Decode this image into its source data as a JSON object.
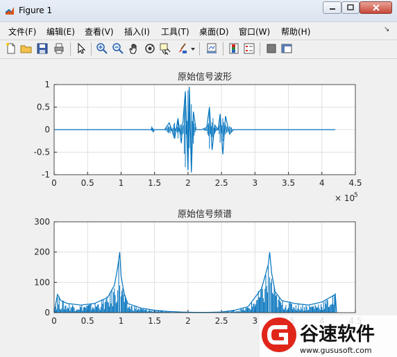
{
  "window": {
    "title": "Figure 1"
  },
  "menu": {
    "items": [
      {
        "name": "menu-file",
        "label": "文件(F)"
      },
      {
        "name": "menu-edit",
        "label": "编辑(E)"
      },
      {
        "name": "menu-view",
        "label": "查看(V)"
      },
      {
        "name": "menu-insert",
        "label": "插入(I)"
      },
      {
        "name": "menu-tools",
        "label": "工具(T)"
      },
      {
        "name": "menu-desktop",
        "label": "桌面(D)"
      },
      {
        "name": "menu-window",
        "label": "窗口(W)"
      },
      {
        "name": "menu-help",
        "label": "帮助(H)"
      }
    ]
  },
  "toolbar": {
    "icons": [
      "new-figure-icon",
      "open-file-icon",
      "save-icon",
      "print-icon",
      "pointer-icon",
      "zoom-in-icon",
      "zoom-out-icon",
      "pan-hand-icon",
      "rotate-3d-icon",
      "data-cursor-icon",
      "brush-icon",
      "dropdown-arrow-icon",
      "link-plot-icon",
      "insert-colorbar-icon",
      "insert-legend-icon",
      "hide-plot-tools-icon",
      "show-plot-tools-icon"
    ]
  },
  "colors": {
    "line": "#0072bd",
    "grid": "#e0e0e0",
    "axis": "#262626"
  },
  "chart_data": [
    {
      "type": "line",
      "title": "原始信号波形",
      "xlabel": "",
      "ylabel": "",
      "xlim": [
        0,
        450000
      ],
      "ylim": [
        -1,
        1
      ],
      "x_ticks": [
        "0",
        "0.5",
        "1",
        "1.5",
        "2",
        "2.5",
        "3",
        "3.5",
        "4",
        "4.5"
      ],
      "y_ticks": [
        "1",
        "0.5",
        "0",
        "-0.5",
        "-1"
      ],
      "x_exponent_label": "× 10",
      "x_exponent_power": "5",
      "grid": true,
      "series": [
        {
          "x": [
            0,
            145000,
            146000,
            148000,
            150000,
            165000,
            172000,
            180000,
            185000,
            190000,
            196000,
            200000,
            202000,
            205000,
            208000,
            212000,
            220000,
            228000,
            232000,
            236000,
            240000,
            245000,
            248000,
            252000,
            256000,
            262000,
            268000,
            300000,
            420000
          ],
          "y": [
            0,
            0,
            0.05,
            -0.05,
            0,
            0,
            0.15,
            -0.2,
            0.25,
            -0.3,
            0.85,
            -0.9,
            0.95,
            -0.95,
            0.4,
            0,
            0,
            0.05,
            0.5,
            -0.45,
            0.1,
            0,
            0.35,
            -0.55,
            0.3,
            -0.1,
            0,
            0,
            0
          ]
        }
      ]
    },
    {
      "type": "line",
      "title": "原始信号频谱",
      "xlabel": "",
      "ylabel": "",
      "xlim": [
        0,
        450000
      ],
      "ylim": [
        0,
        300
      ],
      "x_ticks": [
        "0",
        "0.5",
        "1",
        "1.5",
        "2",
        "2.5",
        "3",
        "3.5",
        "4",
        "4.5"
      ],
      "y_ticks": [
        "300",
        "200",
        "100",
        "0"
      ],
      "grid": true,
      "series": [
        {
          "x": [
            0,
            5000,
            10000,
            20000,
            40000,
            60000,
            80000,
            90000,
            95000,
            98000,
            100000,
            105000,
            110000,
            130000,
            150000,
            170000,
            190000,
            210000,
            230000,
            250000,
            270000,
            290000,
            310000,
            320000,
            322000,
            325000,
            330000,
            340000,
            360000,
            380000,
            400000,
            420000,
            422000
          ],
          "y": [
            0,
            60,
            40,
            30,
            25,
            30,
            50,
            90,
            150,
            200,
            120,
            60,
            30,
            15,
            8,
            4,
            2,
            1,
            1,
            2,
            8,
            20,
            80,
            160,
            200,
            130,
            70,
            40,
            30,
            25,
            35,
            60,
            0
          ]
        }
      ]
    }
  ],
  "watermark": {
    "brand": "谷速软件",
    "url": "www.gususoft.com"
  }
}
